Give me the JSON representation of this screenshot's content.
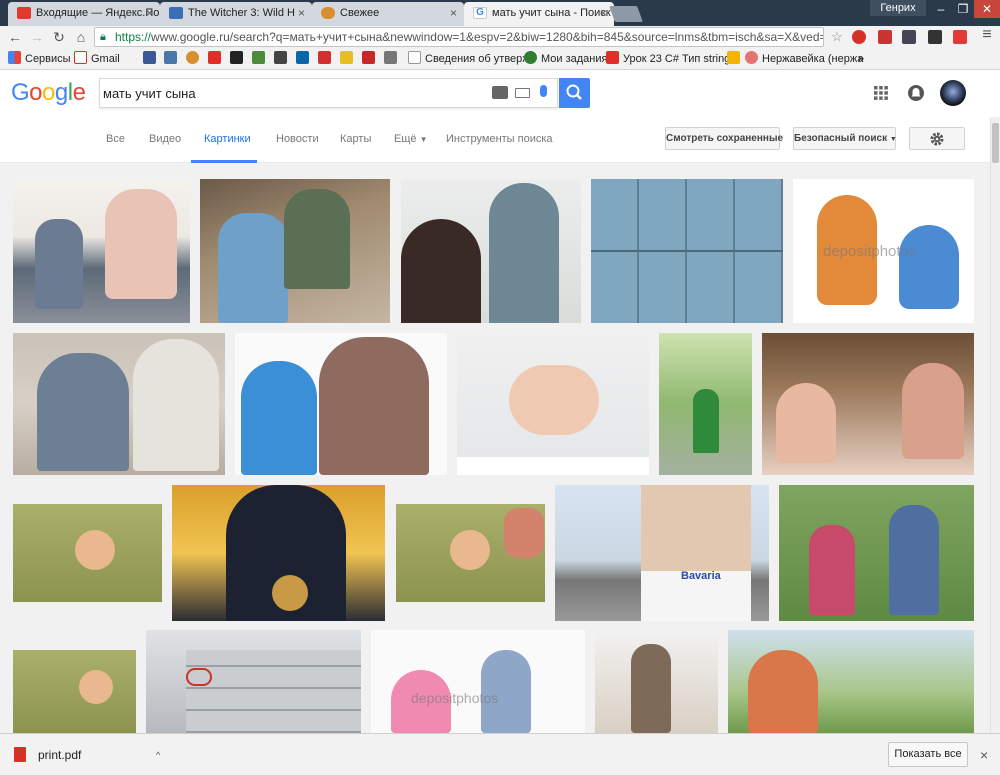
{
  "browser": {
    "tabs": [
      {
        "label": "Входящие — Яндекс.По"
      },
      {
        "label": "The Witcher 3: Wild H"
      },
      {
        "label": "Свежее"
      },
      {
        "label": "мать учит сына - Поиск"
      }
    ],
    "profile_name": "Генрих",
    "url_https": "https://",
    "url_rest": "www.google.ru/search?q=мать+учит+сына&newwindow=1&espv=2&biw=1280&bih=845&source=lnms&tbm=isch&sa=X&ved=0ahUKE"
  },
  "bookmarks": [
    {
      "label": "Сервисы"
    },
    {
      "label": "Gmail"
    },
    {
      "label": "Сведения об утверж"
    },
    {
      "label": "Мои задания"
    },
    {
      "label": "Урок 23 C# Тип string"
    },
    {
      "label": "Нержавейка (нержа"
    }
  ],
  "google": {
    "logo": "Google",
    "query": "мать учит сына",
    "nav": {
      "all": "Все",
      "video": "Видео",
      "images": "Картинки",
      "news": "Новости",
      "maps": "Карты",
      "more": "Ещё",
      "tools": "Инструменты поиска"
    },
    "saved_button": "Смотреть сохраненные",
    "safe_search": "Безопасный поиск"
  },
  "watermarks": {
    "depositphotos": "depositphotos",
    "bavaria": "Bavaria"
  },
  "download": {
    "filename": "print.pdf",
    "show_all": "Показать все"
  },
  "colors": {
    "accent": "#4285f4",
    "google_blue": "#4285f4",
    "google_red": "#ea4335",
    "google_yellow": "#fbbc05",
    "google_green": "#34a853"
  }
}
